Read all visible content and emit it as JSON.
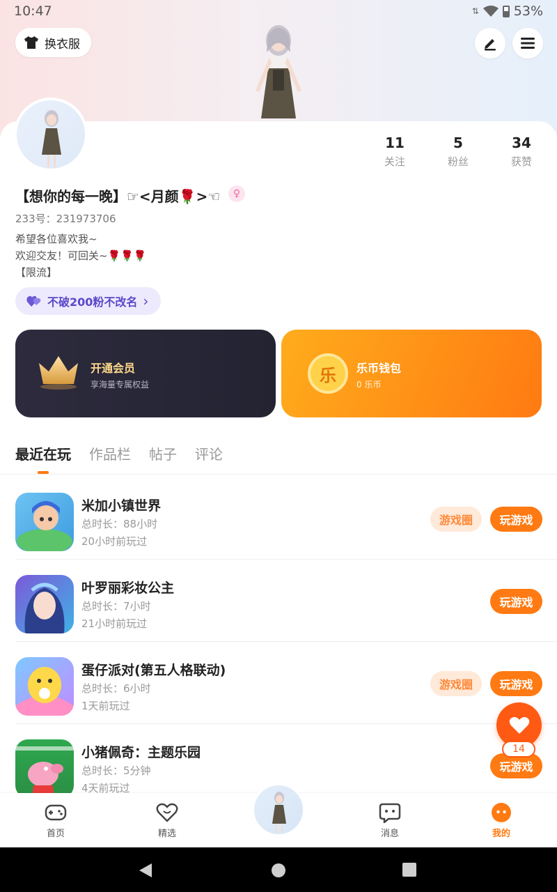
{
  "status_bar": {
    "time": "10:47",
    "battery": "53%"
  },
  "top_actions": {
    "dress_label": "换衣服"
  },
  "profile": {
    "nickname": "【想你的每一晚】☞<月颜🌹>☜",
    "gender_symbol": "♀",
    "uid": "233号：231973706",
    "bio": [
      "希望各位喜欢我~",
      "欢迎交友！可回关~🌹🌹🌹",
      "【限流】"
    ],
    "stats": [
      {
        "value": "11",
        "label": "关注"
      },
      {
        "value": "5",
        "label": "粉丝"
      },
      {
        "value": "34",
        "label": "获赞"
      }
    ],
    "group_pill": "不破200粉不改名"
  },
  "cards": {
    "vip": {
      "title": "开通会员",
      "subtitle": "享海量专属权益"
    },
    "wallet": {
      "title": "乐币钱包",
      "subtitle": "0 乐币",
      "coin_char": "乐"
    }
  },
  "tabs": [
    {
      "label": "最近在玩",
      "active": true
    },
    {
      "label": "作品栏",
      "active": false
    },
    {
      "label": "帖子",
      "active": false
    },
    {
      "label": "评论",
      "active": false
    }
  ],
  "games": [
    {
      "name": "米加小镇世界",
      "duration": "总时长：88小时",
      "last_played": "20小时前玩过",
      "circle_label": "游戏圈",
      "play_label": "玩游戏"
    },
    {
      "name": "叶罗丽彩妆公主",
      "duration": "总时长：7小时",
      "last_played": "21小时前玩过",
      "circle_label": "",
      "play_label": "玩游戏"
    },
    {
      "name": "蛋仔派对(第五人格联动)",
      "duration": "总时长：6小时",
      "last_played": "1天前玩过",
      "circle_label": "游戏圈",
      "play_label": "玩游戏"
    },
    {
      "name": "小猪佩奇：主题乐园",
      "duration": "总时长：5分钟",
      "last_played": "4天前玩过",
      "circle_label": "",
      "play_label": "玩游戏"
    }
  ],
  "fab": {
    "count": "14"
  },
  "bottom_nav": [
    {
      "label": "首页",
      "icon": "gamepad-icon"
    },
    {
      "label": "精选",
      "icon": "heart-outline-icon"
    },
    {
      "label": "消息",
      "icon": "message-icon"
    },
    {
      "label": "我的",
      "icon": "me-face-icon"
    }
  ],
  "colors": {
    "accent": "#ff7a12",
    "purple": "#5a49c9",
    "vip_bg": "#2d2b3d"
  }
}
